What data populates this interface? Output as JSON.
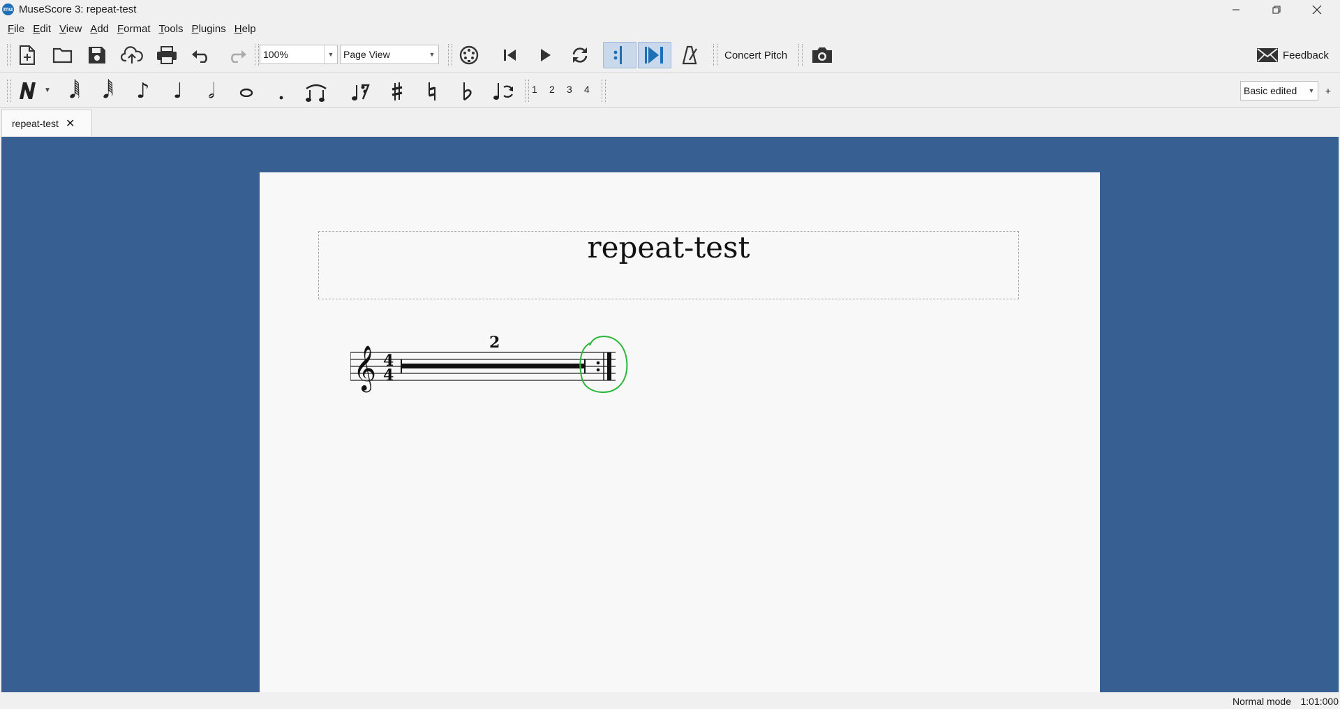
{
  "window": {
    "app_icon": "mu",
    "title": "MuseScore 3: repeat-test"
  },
  "menu": [
    "File",
    "Edit",
    "View",
    "Add",
    "Format",
    "Tools",
    "Plugins",
    "Help"
  ],
  "toolbar": {
    "zoom_value": "100%",
    "view_mode": "Page View",
    "concert_pitch_label": "Concert Pitch",
    "feedback_label": "Feedback",
    "loop_in_active": true,
    "loop_out_active": true
  },
  "note_input": {
    "voices": [
      "1",
      "2",
      "3",
      "4"
    ],
    "workspace": "Basic edited",
    "add_workspace": "+"
  },
  "tabs": [
    {
      "label": "repeat-test",
      "close": "✕"
    }
  ],
  "score": {
    "title": "repeat-test",
    "time_signature_top": "4",
    "time_signature_bottom": "4",
    "multimeasure_rest_count": "2",
    "annotation_color": "#2db53b"
  },
  "status": {
    "mode": "Normal mode",
    "position": "1:01:000"
  },
  "colors": {
    "canvas_background": "#385f92",
    "page": "#f8f8f8",
    "toggle_active": "#1f6fb5"
  }
}
